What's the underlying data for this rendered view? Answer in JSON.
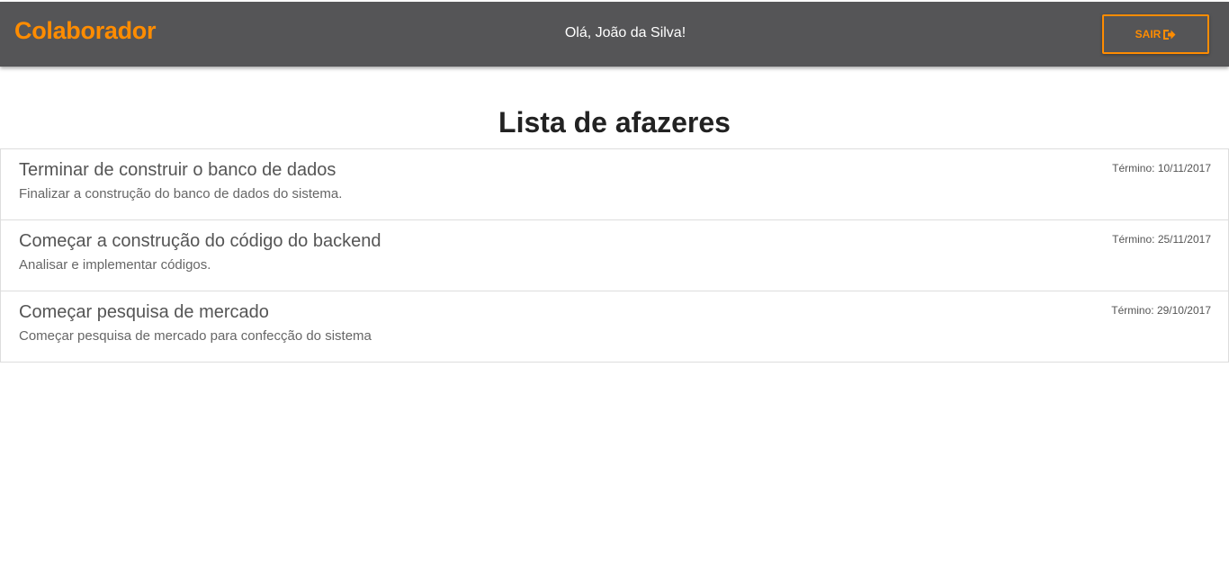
{
  "header": {
    "brand": "Colaborador",
    "greeting": "Olá, João da Silva!",
    "logout_label": "SAIR",
    "logout_icon": "sign-out-icon",
    "accent_color": "#ff8c00",
    "bar_color": "#555557"
  },
  "main": {
    "title": "Lista de afazeres",
    "tasks": [
      {
        "title": "Terminar de construir o banco de dados",
        "description": "Finalizar a construção do banco de dados do sistema.",
        "due_label": "Término:",
        "due_date": "10/11/2017"
      },
      {
        "title": "Começar a construção do código do backend",
        "description": "Analisar e implementar códigos.",
        "due_label": "Término:",
        "due_date": "25/11/2017"
      },
      {
        "title": "Começar pesquisa de mercado",
        "description": "Começar pesquisa de mercado para confecção do sistema",
        "due_label": "Término:",
        "due_date": "29/10/2017"
      }
    ]
  }
}
